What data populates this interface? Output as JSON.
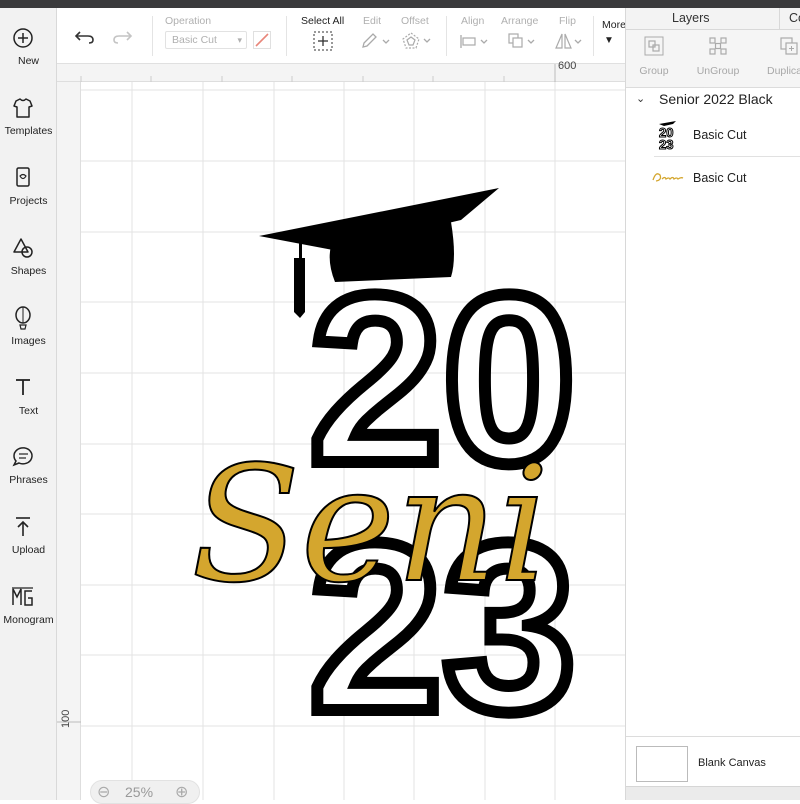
{
  "sidebar": {
    "items": [
      {
        "label": "New",
        "icon": "plus-circle-icon"
      },
      {
        "label": "Templates",
        "icon": "tshirt-icon"
      },
      {
        "label": "Projects",
        "icon": "projects-icon"
      },
      {
        "label": "Shapes",
        "icon": "shapes-icon"
      },
      {
        "label": "Images",
        "icon": "balloon-icon"
      },
      {
        "label": "Text",
        "icon": "text-icon"
      },
      {
        "label": "Phrases",
        "icon": "speech-bubble-icon"
      },
      {
        "label": "Upload",
        "icon": "upload-icon"
      },
      {
        "label": "Monogram",
        "icon": "monogram-icon"
      }
    ]
  },
  "toolbar": {
    "operation_label": "Operation",
    "operation_value": "Basic Cut",
    "select_all_label": "Select All",
    "edit_label": "Edit",
    "offset_label": "Offset",
    "align_label": "Align",
    "arrange_label": "Arrange",
    "flip_label": "Flip",
    "more_label": "More"
  },
  "ruler": {
    "top_mark": "600",
    "left_mark": "100"
  },
  "canvas": {
    "year_top": "20",
    "year_bottom": "23",
    "script_word": "Seni",
    "ink_color": "#000000",
    "gold_color": "#d4a62e"
  },
  "zoom": {
    "value": "25%"
  },
  "panel": {
    "tab_layers": "Layers",
    "tab_color": "Co",
    "actions": [
      {
        "label": "Group",
        "icon": "group-icon"
      },
      {
        "label": "UnGroup",
        "icon": "ungroup-icon"
      },
      {
        "label": "Duplica",
        "icon": "duplicate-icon"
      }
    ],
    "group_name": "Senior 2022 Black",
    "layers": [
      {
        "label": "Basic Cut",
        "thumb": "2023-thumb"
      },
      {
        "label": "Basic Cut",
        "thumb": "senior-thumb"
      }
    ],
    "blank_canvas": "Blank Canvas"
  }
}
